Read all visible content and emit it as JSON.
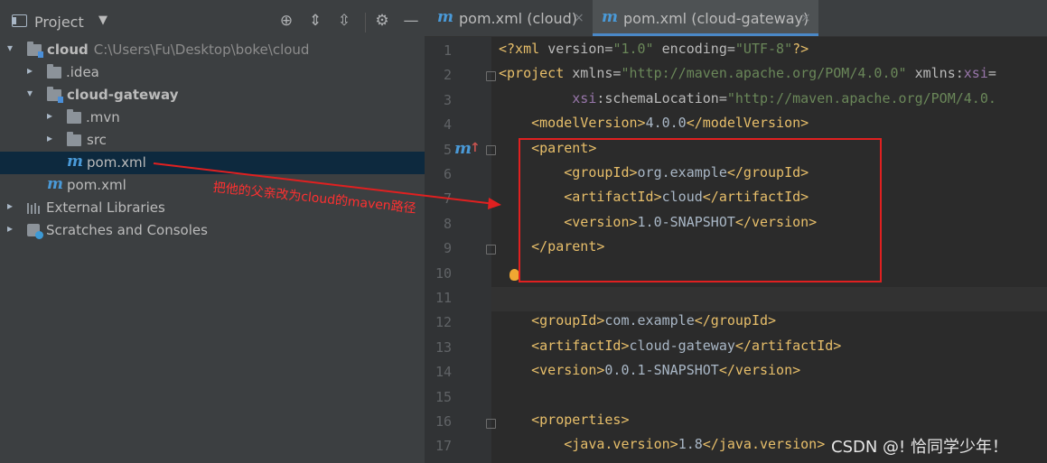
{
  "project_panel": {
    "title": "Project",
    "dropdown_glyph": "▼",
    "toolbar": [
      {
        "name": "locate-icon",
        "glyph": "⊕"
      },
      {
        "name": "expand-all-icon",
        "glyph": "⇕"
      },
      {
        "name": "collapse-all-icon",
        "glyph": "⇳"
      },
      {
        "name": "settings-gear-icon",
        "glyph": "⚙"
      },
      {
        "name": "hide-panel-icon",
        "glyph": "—"
      }
    ],
    "tree": {
      "root_name": "cloud",
      "root_path": "C:\\Users\\Fu\\Desktop\\boke\\cloud",
      "idea": ".idea",
      "gateway": "cloud-gateway",
      "mvn": ".mvn",
      "src": "src",
      "gateway_pom": "pom.xml",
      "root_pom": "pom.xml",
      "ext_libs": "External Libraries",
      "scratches": "Scratches and Consoles"
    }
  },
  "editor": {
    "tabs": [
      {
        "label": "pom.xml (cloud)",
        "active": false
      },
      {
        "label": "pom.xml (cloud-gateway)",
        "active": true
      }
    ],
    "close_glyph": "×",
    "line_numbers": [
      "1",
      "2",
      "3",
      "4",
      "5",
      "6",
      "7",
      "8",
      "9",
      "10",
      "11",
      "12",
      "13",
      "14",
      "15",
      "16",
      "17"
    ],
    "lines": [
      {
        "pre": "",
        "tag": "<?xml ",
        "attr": "version=",
        "str": "\"1.0\"",
        "attr2": " encoding=",
        "str2": "\"UTF-8\"",
        "post": "?>"
      },
      {
        "pre": "",
        "tag": "<project ",
        "attr": "xmlns=",
        "str": "\"http://maven.apache.org/POM/4.0.0\"",
        "attr2": " xmlns:",
        "ns": "xsi",
        "post": "="
      },
      {
        "pre": "         ",
        "ns": "xsi",
        "attr": ":schemaLocation=",
        "str": "\"http://maven.apache.org/POM/4.0."
      },
      {
        "pre": "    ",
        "open": "<modelVersion>",
        "text": "4.0.0",
        "close": "</modelVersion>"
      },
      {
        "pre": "    ",
        "open": "<parent>",
        "text": "",
        "close": ""
      },
      {
        "pre": "        ",
        "open": "<groupId>",
        "text": "org.example",
        "close": "</groupId>"
      },
      {
        "pre": "        ",
        "open": "<artifactId>",
        "text": "cloud",
        "close": "</artifactId>"
      },
      {
        "pre": "        ",
        "open": "<version>",
        "text": "1.0-SNAPSHOT",
        "close": "</version>"
      },
      {
        "pre": "    ",
        "open": "</parent>",
        "text": "",
        "close": ""
      },
      {
        "pre": "",
        "open": "",
        "text": "",
        "close": ""
      },
      {
        "pre": "",
        "open": "",
        "text": "",
        "close": ""
      },
      {
        "pre": "    ",
        "open": "<groupId>",
        "text": "com.example",
        "close": "</groupId>"
      },
      {
        "pre": "    ",
        "open": "<artifactId>",
        "text": "cloud-gateway",
        "close": "</artifactId>"
      },
      {
        "pre": "    ",
        "open": "<version>",
        "text": "0.0.1-SNAPSHOT",
        "close": "</version>"
      },
      {
        "pre": "",
        "open": "",
        "text": "",
        "close": ""
      },
      {
        "pre": "    ",
        "open": "<properties>",
        "text": "",
        "close": ""
      },
      {
        "pre": "        ",
        "open": "<java.version>",
        "text": "1.8",
        "close": "</java.version>"
      }
    ]
  },
  "annotation": {
    "text": "把他的父亲改为cloud的maven路径",
    "color": "#e02020"
  },
  "watermark": "CSDN @! 恰同学少年！"
}
